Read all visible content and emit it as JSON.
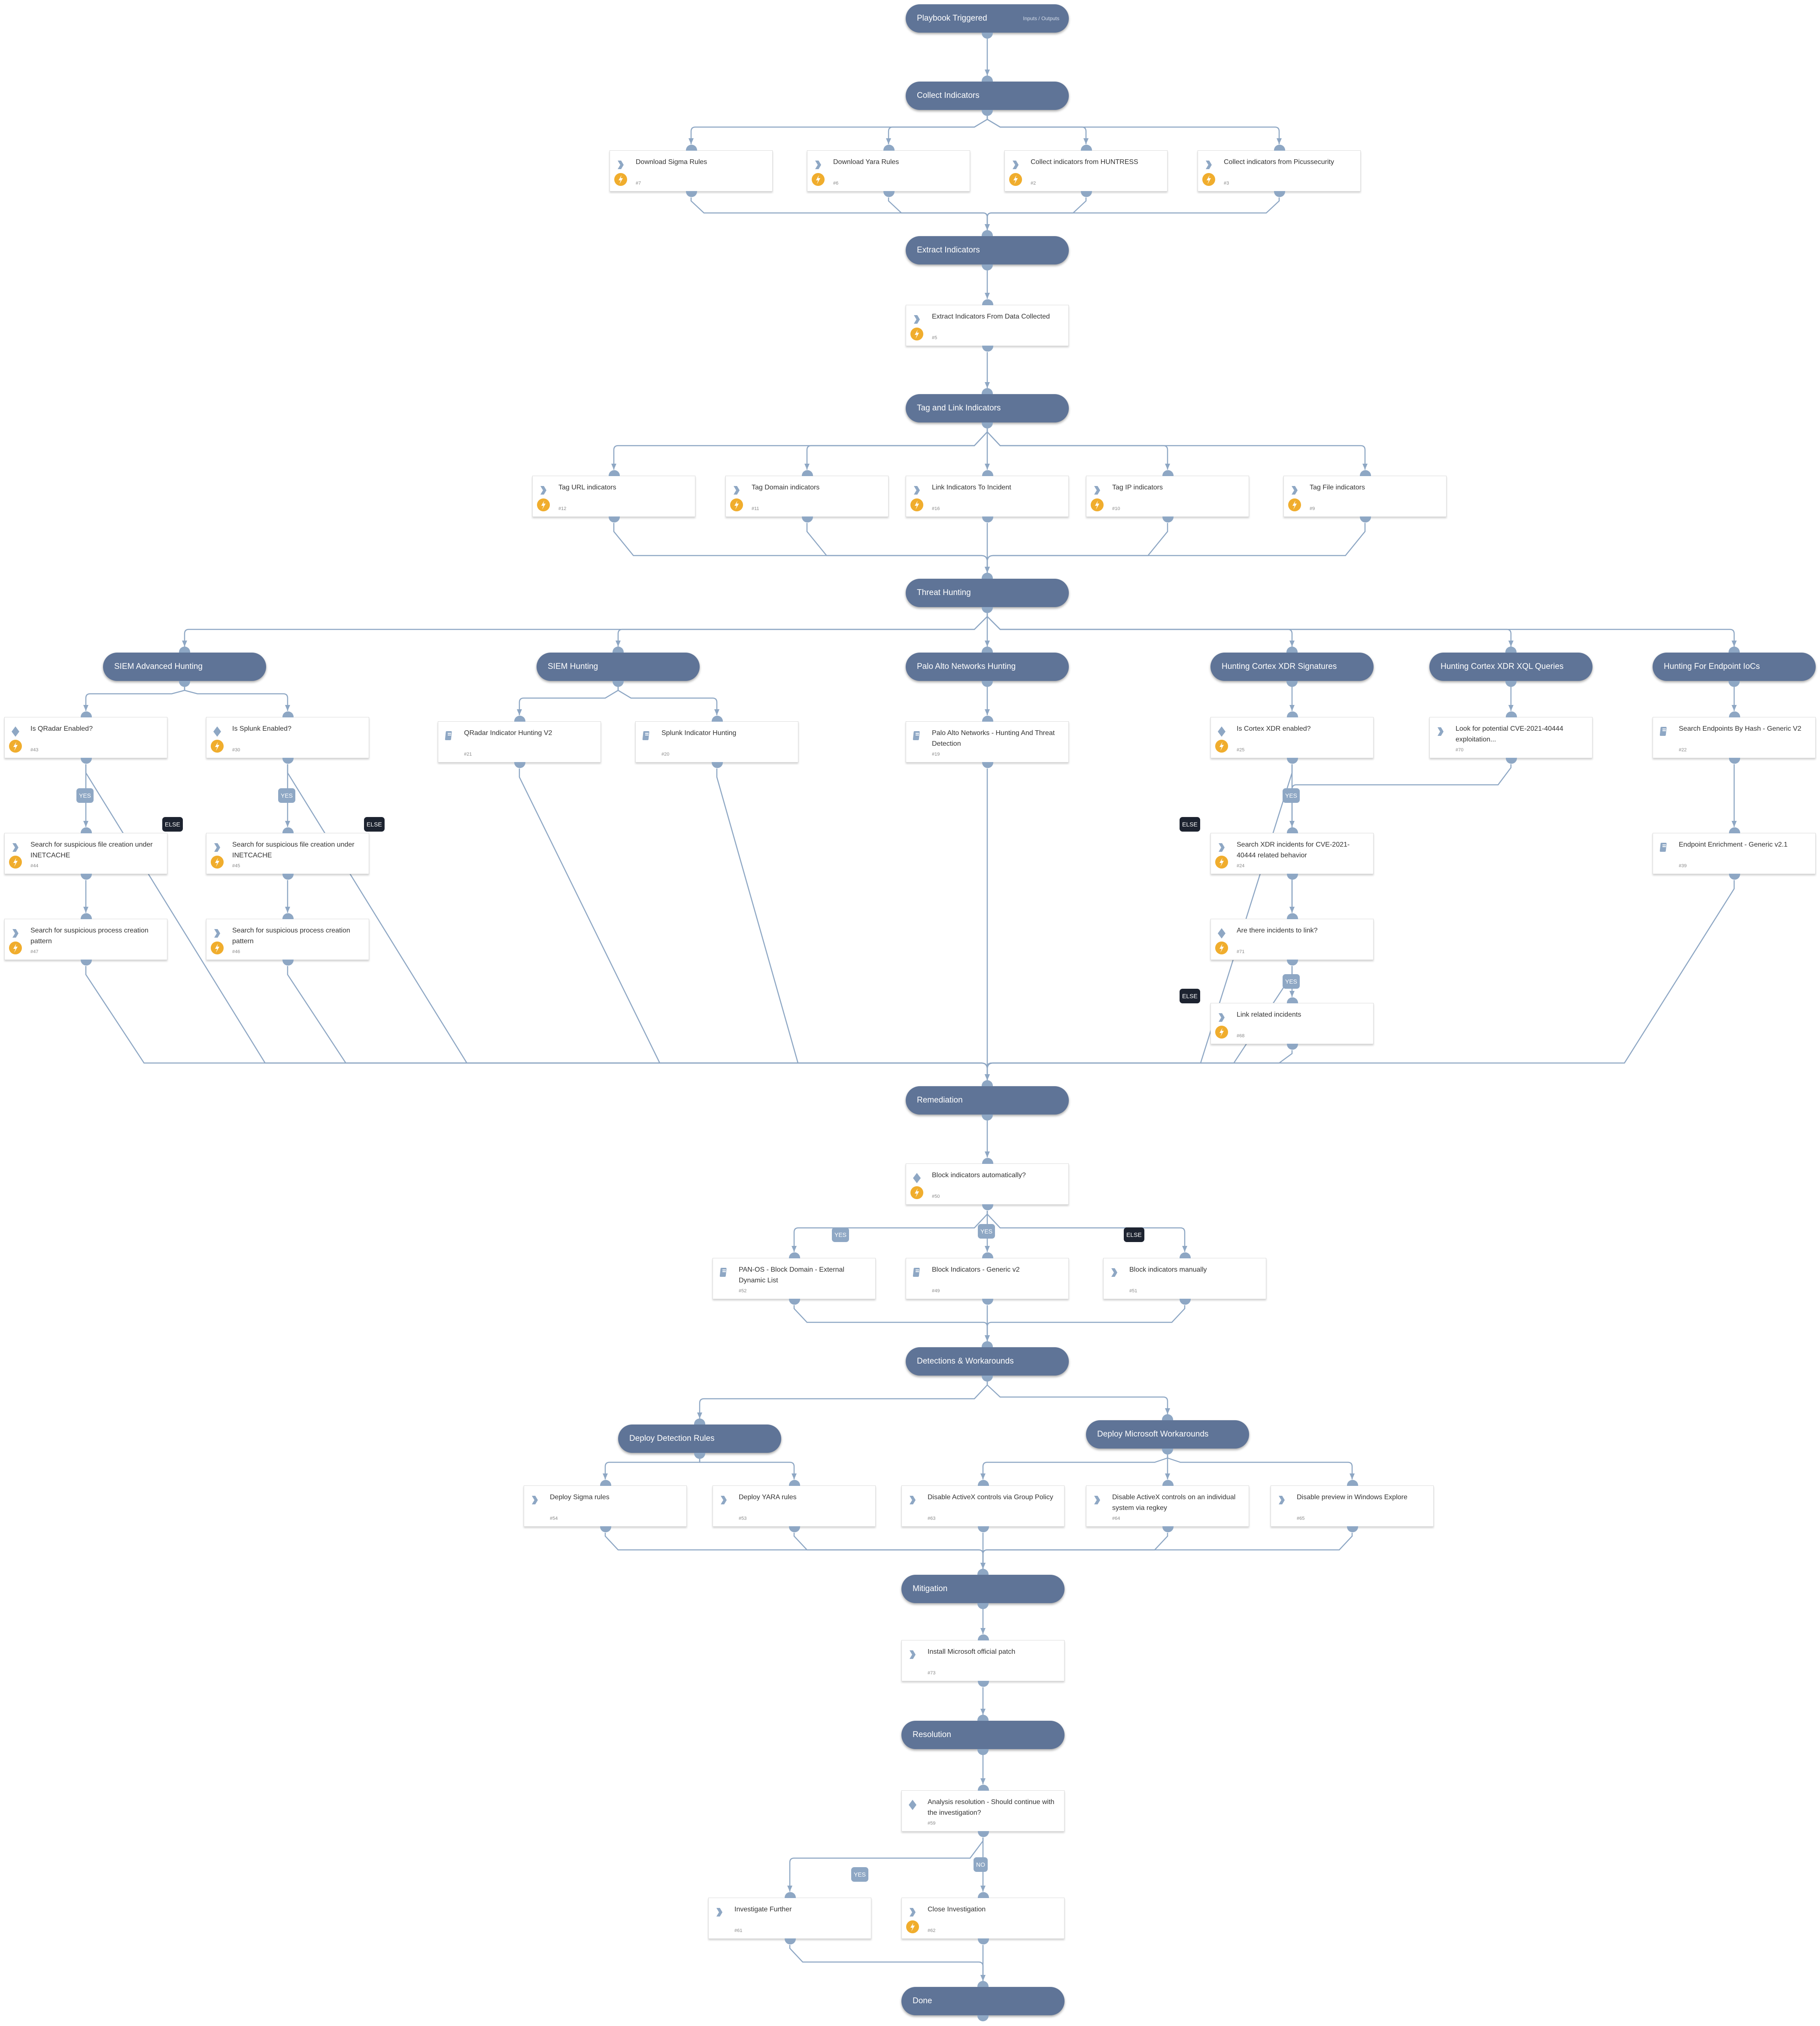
{
  "colors": {
    "section_bg": "#5f7497",
    "edge": "#8ea7c4",
    "automated_badge": "#f0ad2d",
    "else_label": "#1d2330"
  },
  "sections": {
    "trigger": {
      "label": "Playbook Triggered",
      "io": "Inputs / Outputs"
    },
    "collect": {
      "label": "Collect Indicators"
    },
    "extract": {
      "label": "Extract Indicators"
    },
    "tag_link": {
      "label": "Tag and Link Indicators"
    },
    "threat_hunting": {
      "label": "Threat Hunting"
    },
    "siem_adv": {
      "label": "SIEM Advanced Hunting"
    },
    "siem": {
      "label": "SIEM Hunting"
    },
    "pan_hunting": {
      "label": "Palo Alto Networks Hunting"
    },
    "xdr_sig": {
      "label": "Hunting Cortex XDR Signatures"
    },
    "xdr_xql": {
      "label": "Hunting Cortex XDR XQL Queries"
    },
    "endpoint_iocs": {
      "label": "Hunting For Endpoint IoCs"
    },
    "remediation": {
      "label": "Remediation"
    },
    "det_work": {
      "label": "Detections & Workarounds"
    },
    "deploy_rules": {
      "label": "Deploy Detection Rules"
    },
    "ms_work": {
      "label": "Deploy Microsoft Workarounds"
    },
    "mitigation": {
      "label": "Mitigation"
    },
    "resolution": {
      "label": "Resolution"
    },
    "done": {
      "label": "Done"
    }
  },
  "tasks": {
    "t7": {
      "title": "Download Sigma Rules",
      "num": "#7",
      "kind": "manual",
      "automated": true
    },
    "t6": {
      "title": "Download Yara Rules",
      "num": "#6",
      "kind": "manual",
      "automated": true
    },
    "t2": {
      "title": "Collect indicators from HUNTRESS",
      "num": "#2",
      "kind": "manual",
      "automated": true
    },
    "t3": {
      "title": "Collect indicators from Picussecurity",
      "num": "#3",
      "kind": "manual",
      "automated": true
    },
    "t5": {
      "title": "Extract Indicators From Data Collected",
      "num": "#5",
      "kind": "manual",
      "automated": true
    },
    "t12": {
      "title": "Tag URL indicators",
      "num": "#12",
      "kind": "manual",
      "automated": true
    },
    "t11": {
      "title": "Tag Domain indicators",
      "num": "#11",
      "kind": "manual",
      "automated": true
    },
    "t16": {
      "title": "Link Indicators To Incident",
      "num": "#16",
      "kind": "manual",
      "automated": true
    },
    "t10": {
      "title": "Tag IP indicators",
      "num": "#10",
      "kind": "manual",
      "automated": true
    },
    "t9": {
      "title": "Tag File indicators",
      "num": "#9",
      "kind": "manual",
      "automated": true
    },
    "t43": {
      "title": "Is QRadar Enabled?",
      "num": "#43",
      "kind": "condition",
      "automated": true
    },
    "t30": {
      "title": "Is Splunk Enabled?",
      "num": "#30",
      "kind": "condition",
      "automated": true
    },
    "t21": {
      "title": "QRadar Indicator Hunting V2",
      "num": "#21",
      "kind": "playbook",
      "automated": false
    },
    "t20": {
      "title": "Splunk Indicator Hunting",
      "num": "#20",
      "kind": "playbook",
      "automated": false
    },
    "t19": {
      "title": "Palo Alto Networks - Hunting And Threat Detection",
      "num": "#19",
      "kind": "playbook",
      "automated": false
    },
    "t25": {
      "title": "Is Cortex XDR enabled?",
      "num": "#25",
      "kind": "condition",
      "automated": true
    },
    "t70": {
      "title": "Look for potential CVE-2021-40444 exploitation...",
      "num": "#70",
      "kind": "manual",
      "automated": false
    },
    "t22": {
      "title": "Search Endpoints By Hash - Generic V2",
      "num": "#22",
      "kind": "playbook",
      "automated": false
    },
    "t44": {
      "title": "Search for suspicious file creation under INETCACHE",
      "num": "#44",
      "kind": "manual",
      "automated": true
    },
    "t45": {
      "title": "Search for suspicious file creation under INETCACHE",
      "num": "#45",
      "kind": "manual",
      "automated": true
    },
    "t47": {
      "title": "Search for suspicious process creation pattern",
      "num": "#47",
      "kind": "manual",
      "automated": true
    },
    "t46": {
      "title": "Search for suspicious process creation pattern",
      "num": "#46",
      "kind": "manual",
      "automated": true
    },
    "t24": {
      "title": "Search XDR incidents for CVE-2021-40444 related behavior",
      "num": "#24",
      "kind": "manual",
      "automated": true
    },
    "t39": {
      "title": "Endpoint Enrichment - Generic v2.1",
      "num": "#39",
      "kind": "playbook",
      "automated": false
    },
    "t71": {
      "title": "Are there incidents to link?",
      "num": "#71",
      "kind": "condition",
      "automated": true
    },
    "t68": {
      "title": "Link related incidents",
      "num": "#68",
      "kind": "manual",
      "automated": true
    },
    "t50": {
      "title": "Block indicators automatically?",
      "num": "#50",
      "kind": "condition",
      "automated": true
    },
    "t52": {
      "title": "PAN-OS - Block Domain - External Dynamic List",
      "num": "#52",
      "kind": "playbook",
      "automated": false
    },
    "t49": {
      "title": "Block Indicators - Generic v2",
      "num": "#49",
      "kind": "playbook",
      "automated": false
    },
    "t51": {
      "title": "Block indicators manually",
      "num": "#51",
      "kind": "manual",
      "automated": false
    },
    "t54": {
      "title": "Deploy Sigma rules",
      "num": "#54",
      "kind": "manual",
      "automated": false
    },
    "t53": {
      "title": "Deploy YARA rules",
      "num": "#53",
      "kind": "manual",
      "automated": false
    },
    "t63": {
      "title": "Disable ActiveX controls via Group Policy",
      "num": "#63",
      "kind": "manual",
      "automated": false
    },
    "t64": {
      "title": "Disable ActiveX controls on an individual system via regkey",
      "num": "#64",
      "kind": "manual",
      "automated": false
    },
    "t65": {
      "title": "Disable preview in Windows Explore",
      "num": "#65",
      "kind": "manual",
      "automated": false
    },
    "t73": {
      "title": "Install Microsoft official patch",
      "num": "#73",
      "kind": "manual",
      "automated": false
    },
    "t59": {
      "title": "Analysis resolution - Should continue with the investigation?",
      "num": "#59",
      "kind": "condition",
      "automated": false
    },
    "t61": {
      "title": "Investigate Further",
      "num": "#61",
      "kind": "manual",
      "automated": false
    },
    "t62": {
      "title": "Close Investigation",
      "num": "#62",
      "kind": "manual",
      "automated": true
    }
  },
  "branch_labels": {
    "yes": "YES",
    "no": "NO",
    "else": "ELSE"
  },
  "edges": [
    [
      "trigger",
      "collect"
    ],
    [
      "collect",
      "t7"
    ],
    [
      "collect",
      "t6"
    ],
    [
      "collect",
      "t2"
    ],
    [
      "collect",
      "t3"
    ],
    [
      "t7",
      "extract"
    ],
    [
      "t6",
      "extract"
    ],
    [
      "t2",
      "extract"
    ],
    [
      "t3",
      "extract"
    ],
    [
      "extract",
      "t5"
    ],
    [
      "t5",
      "tag_link"
    ],
    [
      "tag_link",
      "t12"
    ],
    [
      "tag_link",
      "t11"
    ],
    [
      "tag_link",
      "t16"
    ],
    [
      "tag_link",
      "t10"
    ],
    [
      "tag_link",
      "t9"
    ],
    [
      "t12",
      "threat_hunting"
    ],
    [
      "t11",
      "threat_hunting"
    ],
    [
      "t16",
      "threat_hunting"
    ],
    [
      "t10",
      "threat_hunting"
    ],
    [
      "t9",
      "threat_hunting"
    ],
    [
      "threat_hunting",
      "siem_adv"
    ],
    [
      "threat_hunting",
      "siem"
    ],
    [
      "threat_hunting",
      "pan_hunting"
    ],
    [
      "threat_hunting",
      "xdr_sig"
    ],
    [
      "threat_hunting",
      "xdr_xql"
    ],
    [
      "threat_hunting",
      "endpoint_iocs"
    ],
    [
      "siem_adv",
      "t43"
    ],
    [
      "siem_adv",
      "t30"
    ],
    [
      "t43",
      "t44",
      "yes"
    ],
    [
      "t43",
      "remediation",
      "else"
    ],
    [
      "t30",
      "t45",
      "yes"
    ],
    [
      "t30",
      "remediation",
      "else"
    ],
    [
      "t44",
      "t47"
    ],
    [
      "t45",
      "t46"
    ],
    [
      "t47",
      "remediation"
    ],
    [
      "t46",
      "remediation"
    ],
    [
      "siem",
      "t21"
    ],
    [
      "siem",
      "t20"
    ],
    [
      "t21",
      "remediation"
    ],
    [
      "t20",
      "remediation"
    ],
    [
      "pan_hunting",
      "t19"
    ],
    [
      "t19",
      "remediation"
    ],
    [
      "xdr_sig",
      "t25"
    ],
    [
      "t25",
      "t24",
      "yes"
    ],
    [
      "t25",
      "remediation",
      "else"
    ],
    [
      "t24",
      "t71"
    ],
    [
      "xdr_xql",
      "t70"
    ],
    [
      "t70",
      "t71"
    ],
    [
      "t71",
      "t68",
      "yes"
    ],
    [
      "t71",
      "remediation",
      "else"
    ],
    [
      "t68",
      "remediation"
    ],
    [
      "endpoint_iocs",
      "t22"
    ],
    [
      "t22",
      "t39"
    ],
    [
      "t39",
      "remediation"
    ],
    [
      "remediation",
      "t50"
    ],
    [
      "t50",
      "t52",
      "yes"
    ],
    [
      "t50",
      "t49",
      "yes"
    ],
    [
      "t50",
      "t51",
      "else"
    ],
    [
      "t52",
      "det_work"
    ],
    [
      "t49",
      "det_work"
    ],
    [
      "t51",
      "det_work"
    ],
    [
      "det_work",
      "deploy_rules"
    ],
    [
      "det_work",
      "ms_work"
    ],
    [
      "deploy_rules",
      "t54"
    ],
    [
      "deploy_rules",
      "t53"
    ],
    [
      "ms_work",
      "t63"
    ],
    [
      "ms_work",
      "t64"
    ],
    [
      "ms_work",
      "t65"
    ],
    [
      "t54",
      "mitigation"
    ],
    [
      "t53",
      "mitigation"
    ],
    [
      "t63",
      "mitigation"
    ],
    [
      "t64",
      "mitigation"
    ],
    [
      "t65",
      "mitigation"
    ],
    [
      "mitigation",
      "t73"
    ],
    [
      "t73",
      "resolution"
    ],
    [
      "resolution",
      "t59"
    ],
    [
      "t59",
      "t61",
      "yes"
    ],
    [
      "t59",
      "t62",
      "no"
    ],
    [
      "t61",
      "done"
    ],
    [
      "t62",
      "done"
    ]
  ]
}
